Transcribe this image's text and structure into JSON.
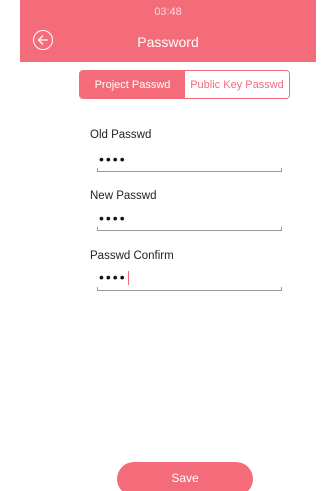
{
  "status_bar": {
    "time": "03:48"
  },
  "header": {
    "title": "Password",
    "back_icon": "back-arrow-circle-icon"
  },
  "tabs": [
    {
      "label": "Project Passwd",
      "active": true
    },
    {
      "label": "Public Key Passwd",
      "active": false
    }
  ],
  "form": {
    "old_passwd": {
      "label": "Old Passwd",
      "value": "••••"
    },
    "new_passwd": {
      "label": "New Passwd",
      "value": "••••"
    },
    "confirm_passwd": {
      "label": "Passwd Confirm",
      "value": "••••"
    }
  },
  "save_label": "Save",
  "colors": {
    "accent": "#f46c7a",
    "underline": "#9a9a9a"
  }
}
